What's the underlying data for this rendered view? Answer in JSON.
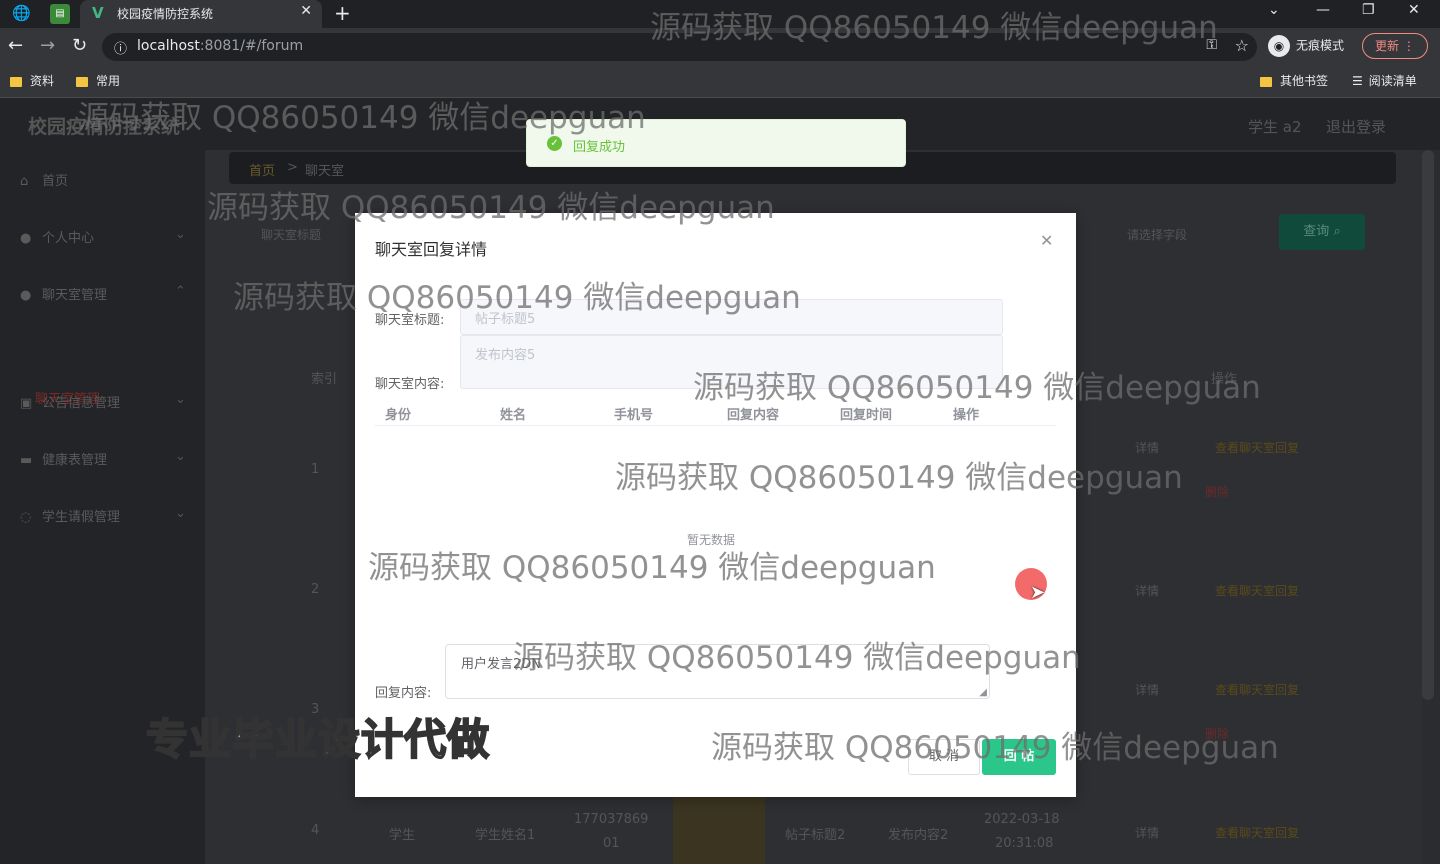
{
  "browser": {
    "tab_title": "校园疫情防控系统",
    "url_host": "localhost",
    "url_rest": ":8081/#/forum",
    "incognito_label": "无痕模式",
    "update_label": "更新",
    "bookmarks": [
      "资料",
      "常用"
    ],
    "bookmarks_right": [
      "其他书签",
      "阅读清单"
    ]
  },
  "app": {
    "title": "校园疫情防控系统",
    "user": "学生 a2",
    "logout": "退出登录",
    "menu": [
      "首页",
      "个人中心",
      "聊天室管理",
      "公告信息管理",
      "健康表管理",
      "学生请假管理"
    ],
    "submenu_active": "聊天室管理",
    "breadcrumb": [
      "首页",
      ">",
      "聊天室"
    ],
    "search_label": "查询",
    "search_placeholder_1": "聊天室标题",
    "search_placeholder_2": "请选择字段",
    "table": {
      "index_header": "索引",
      "action_header": "操作",
      "rows": [
        "1",
        "2",
        "3",
        "4"
      ],
      "row4": {
        "identity": "学生",
        "name": "学生姓名1",
        "phone_a": "177037869",
        "phone_b": "01",
        "title": "帖子标题2",
        "content": "发布内容2",
        "date": "2022-03-18",
        "time": "20:31:08"
      },
      "detail_label": "详情",
      "delete_label": "删除",
      "reply_link": "查看聊天室回复"
    }
  },
  "toast": {
    "message": "回复成功"
  },
  "dialog": {
    "title": "聊天室回复详情",
    "title_label": "聊天室标题:",
    "title_value": "帖子标题5",
    "content_label": "聊天室内容:",
    "content_value": "发布内容5",
    "columns": [
      "身份",
      "姓名",
      "手机号",
      "回复内容",
      "回复时间",
      "操作"
    ],
    "empty": "暂无数据",
    "reply_label": "回复内容:",
    "reply_value": "用户发言2DN",
    "cancel": "取 消",
    "submit": "回 帖"
  },
  "watermarks": {
    "text": "源码获取 QQ86050149 微信deepguan",
    "big": "专业毕业设计代做"
  }
}
